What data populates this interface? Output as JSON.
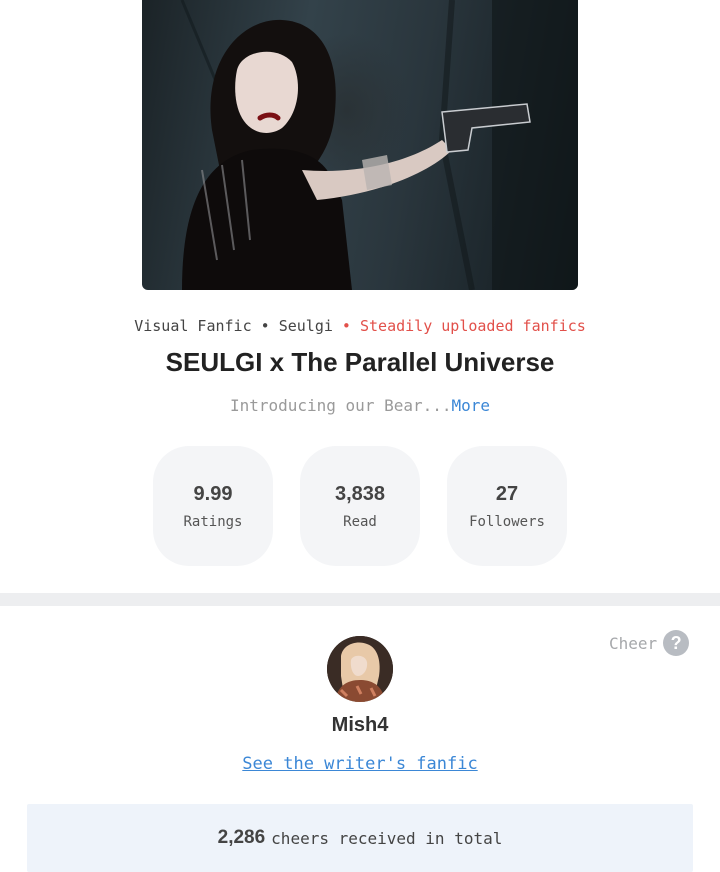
{
  "fanfic": {
    "category": "Visual Fanfic",
    "sep1": " • ",
    "character": "Seulgi",
    "status": " • Steadily uploaded fanfics",
    "title": "SEULGI x The Parallel Universe",
    "intro": "Introducing our Bear...",
    "more_label": "More"
  },
  "stats": [
    {
      "value": "9.99",
      "label": "Ratings"
    },
    {
      "value": "3,838",
      "label": "Read"
    },
    {
      "value": "27",
      "label": "Followers"
    }
  ],
  "writer": {
    "cheer_label": "Cheer",
    "help_glyph": "?",
    "name": "Mish4",
    "link_label": "See the writer's fanfic",
    "cheers_count": "2,286",
    "cheers_text": "cheers received in total"
  },
  "colors": {
    "accent_red": "#e2504a",
    "link_blue": "#3b87d6"
  }
}
